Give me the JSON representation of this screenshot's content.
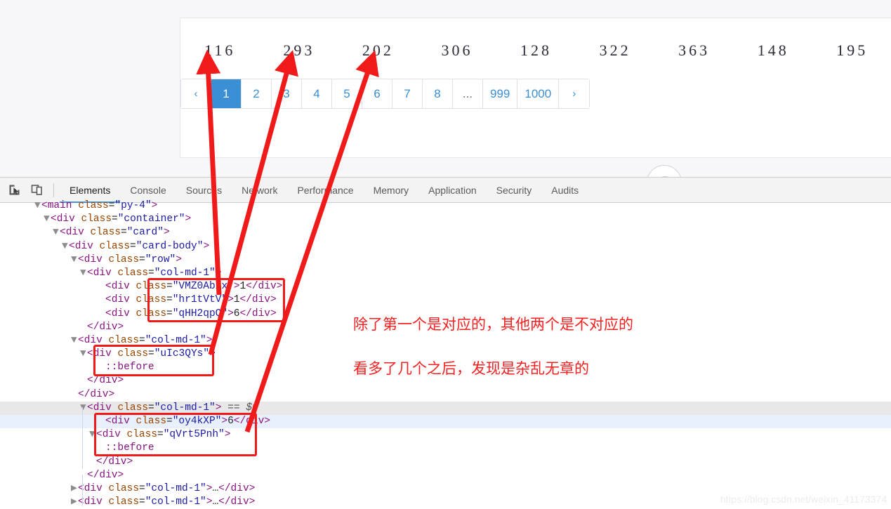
{
  "page": {
    "numbers": [
      "116",
      "293",
      "202",
      "306",
      "128",
      "322",
      "363",
      "148",
      "195"
    ],
    "pagination": {
      "prev_label": "‹",
      "next_label": "›",
      "ellipsis_label": "...",
      "items": [
        "1",
        "2",
        "3",
        "4",
        "5",
        "6",
        "7",
        "8",
        "...",
        "999",
        "1000"
      ],
      "active": "1",
      "active_bg": "#3b8fd4",
      "link_color": "#3b8fd4"
    },
    "scroll_top_icon": "chevron-up-icon"
  },
  "devtools": {
    "toolbar": {
      "inspect_icon": "inspect-element-icon",
      "device_icon": "device-toolbar-icon"
    },
    "tabs": [
      {
        "label": "Elements",
        "active": true
      },
      {
        "label": "Console",
        "active": false
      },
      {
        "label": "Sources",
        "active": false
      },
      {
        "label": "Network",
        "active": false
      },
      {
        "label": "Performance",
        "active": false
      },
      {
        "label": "Memory",
        "active": false
      },
      {
        "label": "Application",
        "active": false
      },
      {
        "label": "Security",
        "active": false
      },
      {
        "label": "Audits",
        "active": false
      }
    ],
    "dom_lines": [
      {
        "indent": 3,
        "twisty": "▼",
        "html": "<span class=\"tag\">&lt;main</span> <span class=\"attr\">class</span>=<span class=\"val\">\"py-4\"</span><span class=\"tag\">&gt;</span>",
        "state": "none"
      },
      {
        "indent": 4,
        "twisty": "▼",
        "html": "<span class=\"tag\">&lt;div</span> <span class=\"attr\">class</span>=<span class=\"val\">\"container\"</span><span class=\"tag\">&gt;</span>",
        "state": "none"
      },
      {
        "indent": 5,
        "twisty": "▼",
        "html": "<span class=\"tag\">&lt;div</span> <span class=\"attr\">class</span>=<span class=\"val\">\"card\"</span><span class=\"tag\">&gt;</span>",
        "state": "none"
      },
      {
        "indent": 6,
        "twisty": "▼",
        "html": "<span class=\"tag\">&lt;div</span> <span class=\"attr\">class</span>=<span class=\"val\">\"card-body\"</span><span class=\"tag\">&gt;</span>",
        "state": "none"
      },
      {
        "indent": 7,
        "twisty": "▼",
        "html": "<span class=\"tag\">&lt;div</span> <span class=\"attr\">class</span>=<span class=\"val\">\"row\"</span><span class=\"tag\">&gt;</span>",
        "state": "none"
      },
      {
        "indent": 8,
        "twisty": "▼",
        "html": "<span class=\"tag\">&lt;div</span> <span class=\"attr\">class</span>=<span class=\"val\">\"col-md-1\"</span><span class=\"tag\">&gt;</span>",
        "state": "none"
      },
      {
        "indent": 10,
        "twisty": "",
        "html": "<span class=\"tag\">&lt;div</span> <span class=\"attr\">class</span>=<span class=\"val\">\"VMZ0Abzx\"</span><span class=\"tag\">&gt;</span><span class=\"txt\">1</span><span class=\"tag\">&lt;/div&gt;</span>",
        "state": "none"
      },
      {
        "indent": 10,
        "twisty": "",
        "html": "<span class=\"tag\">&lt;div</span> <span class=\"attr\">class</span>=<span class=\"val\">\"hr1tVtV\"</span><span class=\"tag\">&gt;</span><span class=\"txt\">1</span><span class=\"tag\">&lt;/div&gt;</span>",
        "state": "none"
      },
      {
        "indent": 10,
        "twisty": "",
        "html": "<span class=\"tag\">&lt;div</span> <span class=\"attr\">class</span>=<span class=\"val\">\"qHH2qpQ\"</span><span class=\"tag\">&gt;</span><span class=\"txt\">6</span><span class=\"tag\">&lt;/div&gt;</span>",
        "state": "none"
      },
      {
        "indent": 8,
        "twisty": "",
        "html": "<span class=\"tag\">&lt;/div&gt;</span>",
        "state": "none"
      },
      {
        "indent": 7,
        "twisty": "▼",
        "html": "<span class=\"tag\">&lt;div</span> <span class=\"attr\">class</span>=<span class=\"val\">\"col-md-1\"</span><span class=\"tag\">&gt;</span>",
        "state": "none"
      },
      {
        "indent": 8,
        "twisty": "▼",
        "html": "<span class=\"tag\">&lt;div</span> <span class=\"attr\">class</span>=<span class=\"val\">\"uIc3QYs\"</span><span class=\"tag\">&gt;</span>",
        "state": "none"
      },
      {
        "indent": 10,
        "twisty": "",
        "html": "<span class=\"pseudo\">::before</span>",
        "state": "none"
      },
      {
        "indent": 8,
        "twisty": "",
        "html": "<span class=\"tag\">&lt;/div&gt;</span>",
        "state": "none"
      },
      {
        "indent": 7,
        "twisty": "",
        "html": "<span class=\"tag\">&lt;/div&gt;</span>",
        "state": "none"
      },
      {
        "indent": 8,
        "twisty": "▼",
        "html": "<span class=\"tag\">&lt;div</span> <span class=\"attr\">class</span>=<span class=\"val\">\"col-md-1\"</span><span class=\"tag\">&gt;</span> <span class=\"dollar\">== $0</span>",
        "state": "sel-gray"
      },
      {
        "indent": 10,
        "twisty": "",
        "html": "<span class=\"tag\">&lt;div</span> <span class=\"attr\">class</span>=<span class=\"val\">\"oy4kXP\"</span><span class=\"tag\">&gt;</span><span class=\"txt\">6</span><span class=\"tag\">&lt;/div&gt;</span>",
        "state": "sel-blue"
      },
      {
        "indent": 9,
        "twisty": "▼",
        "html": "<span class=\"tag\">&lt;div</span> <span class=\"attr\">class</span>=<span class=\"val\">\"qVrt5Pnh\"</span><span class=\"tag\">&gt;</span>",
        "state": "none"
      },
      {
        "indent": 10,
        "twisty": "",
        "html": "<span class=\"pseudo\">::before</span>",
        "state": "none"
      },
      {
        "indent": 9,
        "twisty": "",
        "html": "<span class=\"tag\">&lt;/div&gt;</span>",
        "state": "none"
      },
      {
        "indent": 8,
        "twisty": "",
        "html": "<span class=\"tag\">&lt;/div&gt;</span>",
        "state": "none"
      },
      {
        "indent": 7,
        "twisty": "▶",
        "html": "<span class=\"tag\">&lt;div</span> <span class=\"attr\">class</span>=<span class=\"val\">\"col-md-1\"</span><span class=\"tag\">&gt;</span><span class=\"txt\">…</span><span class=\"tag\">&lt;/div&gt;</span>",
        "state": "none"
      },
      {
        "indent": 7,
        "twisty": "▶",
        "html": "<span class=\"tag\">&lt;div</span> <span class=\"attr\">class</span>=<span class=\"val\">\"col-md-1\"</span><span class=\"tag\">&gt;</span><span class=\"txt\">…</span><span class=\"tag\">&lt;/div&gt;</span>",
        "state": "none"
      }
    ]
  },
  "annotations": {
    "note_line1": "除了第一个是对应的，其他两个是不对应的",
    "note_line2": "看多了几个之后，发现是杂乱无章的",
    "arrow_color": "#f11a1a",
    "box_color": "#f11a1a"
  },
  "watermark": "https://blog.csdn.net/weixin_41173374"
}
